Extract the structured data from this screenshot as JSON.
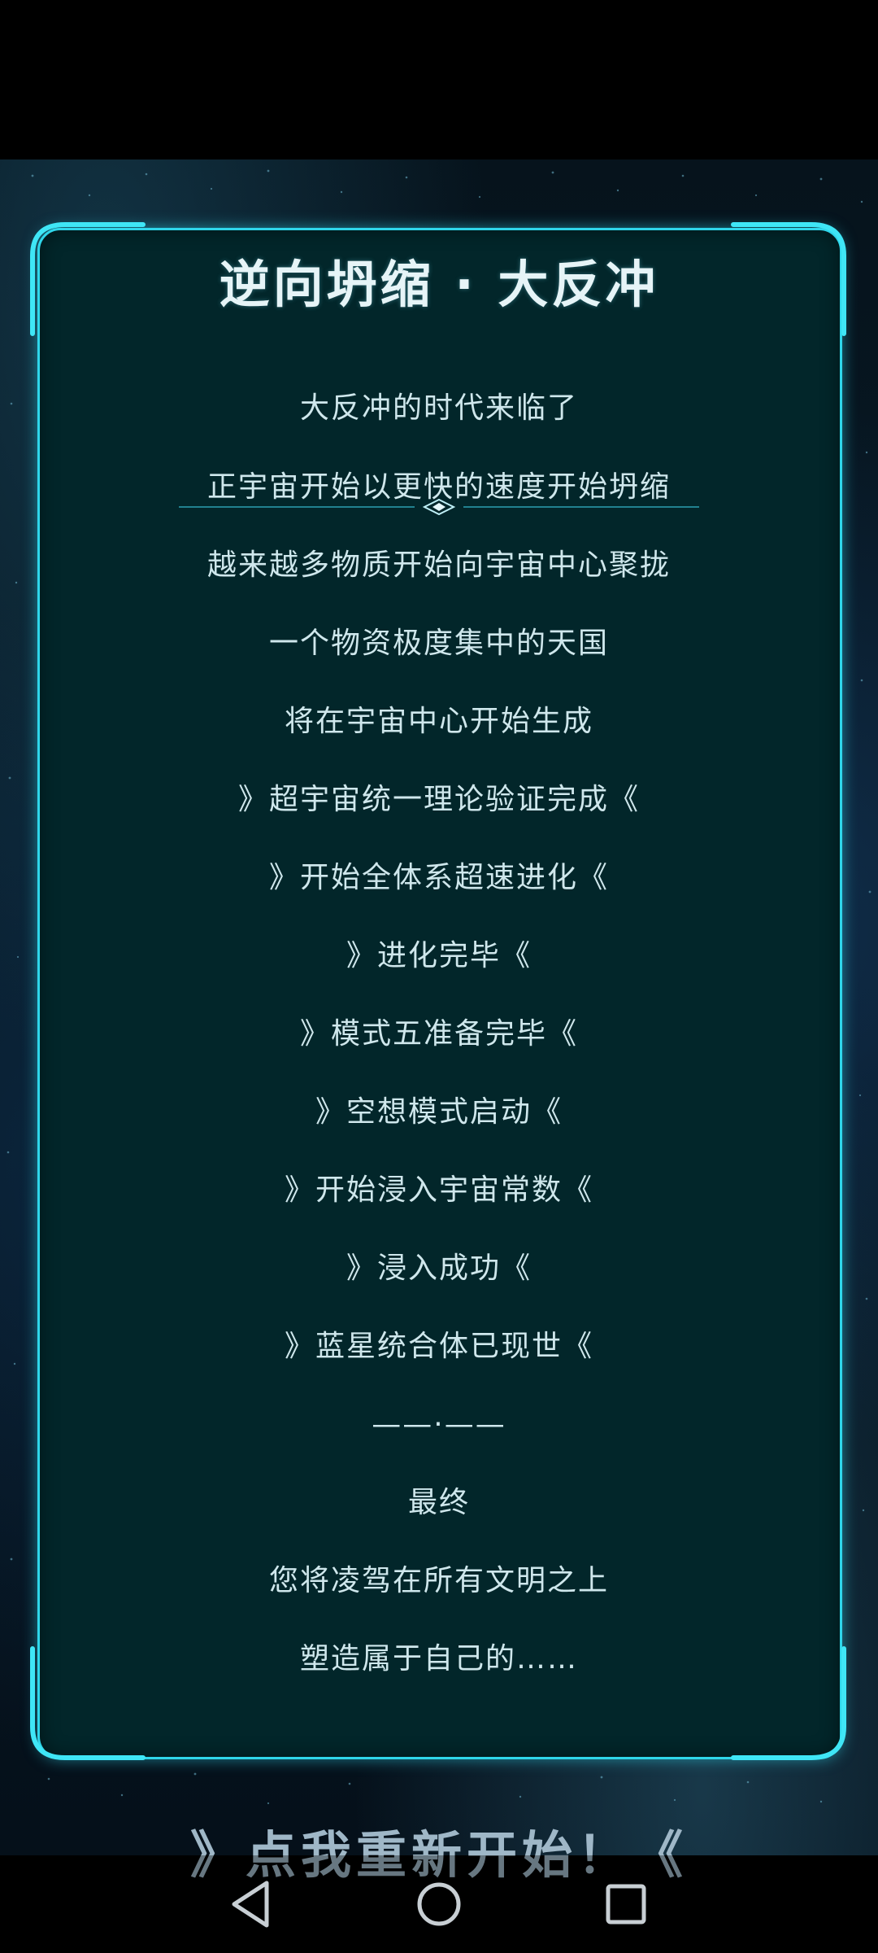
{
  "game": {
    "title": "逆向坍缩 · 大反冲",
    "story_lines": [
      "大反冲的时代来临了",
      "正宇宙开始以更快的速度开始坍缩",
      "越来越多物质开始向宇宙中心聚拢",
      "一个物资极度集中的天国",
      "将在宇宙中心开始生成",
      "》超宇宙统一理论验证完成《",
      "》开始全体系超速进化《",
      "》进化完毕《",
      "》模式五准备完毕《",
      "》空想模式启动《",
      "》开始浸入宇宙常数《",
      "》浸入成功《",
      "》蓝星统合体已现世《",
      "——·——",
      "最终",
      "您将凌驾在所有文明之上",
      "塑造属于自己的……"
    ],
    "restart_label": "》点我重新开始！《"
  },
  "navigation": {
    "back_icon": "back-triangle-icon",
    "home_icon": "home-circle-icon",
    "recents_icon": "recents-square-icon"
  },
  "colors": {
    "panel_bg": "#02262a",
    "panel_border": "#2fd6ea",
    "text": "#cfe7ec",
    "title": "#e6f4f7",
    "restart": "#9fb7c7"
  }
}
